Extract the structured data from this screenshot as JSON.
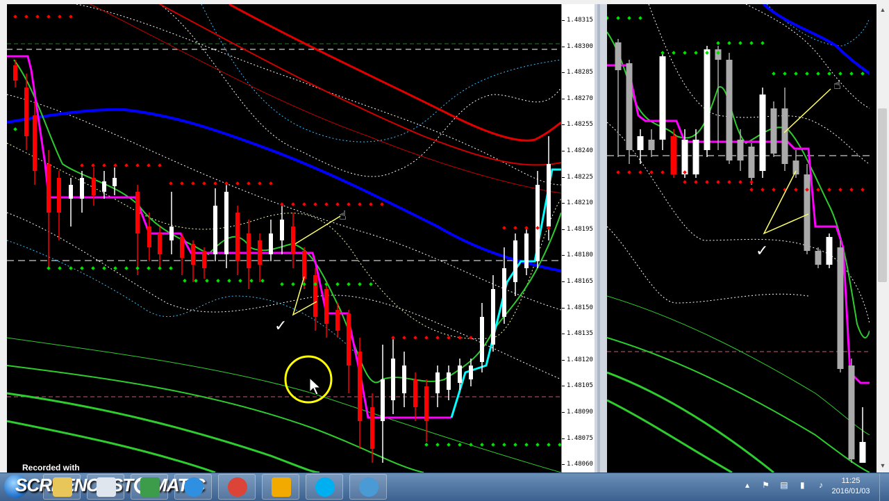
{
  "price_axis": {
    "ticks": [
      "1.48315",
      "1.48300",
      "1.48285",
      "1.48270",
      "1.48255",
      "1.48240",
      "1.48225",
      "1.48210",
      "1.48195",
      "1.48180",
      "1.48165",
      "1.48150",
      "1.48135",
      "1.48120",
      "1.48105",
      "1.48090",
      "1.48075",
      "1.48060"
    ]
  },
  "watermark": {
    "recorded_with": "Recorded with",
    "brand_left": "SCREENCAST",
    "brand_right": "MATIC"
  },
  "taskbar": {
    "apps": [
      {
        "name": "file-explorer",
        "color": "#e8c65a"
      },
      {
        "name": "screencast-recorder",
        "color": "#dfe6ee"
      },
      {
        "name": "spreadsheet",
        "color": "#3c9c4a"
      },
      {
        "name": "web-browser-ie",
        "color": "#2f8fe0"
      },
      {
        "name": "chrome",
        "color": "#db4437"
      },
      {
        "name": "outlook",
        "color": "#f2a900"
      },
      {
        "name": "skype",
        "color": "#00aff0"
      },
      {
        "name": "media-app",
        "color": "#4a9ad6"
      }
    ],
    "clock_time": "11:25",
    "clock_date": "2016/01/03"
  },
  "colors": {
    "bull_candle": "#ffffff",
    "bear_candle": "#ff0000",
    "ma_blue": "#0000ff",
    "ma_red": "#e00000",
    "ma_green": "#2ecc2e",
    "signal_magenta": "#ff00ff",
    "signal_cyan": "#00ffff",
    "dots_green": "#00e000",
    "dots_red": "#ff0000"
  }
}
